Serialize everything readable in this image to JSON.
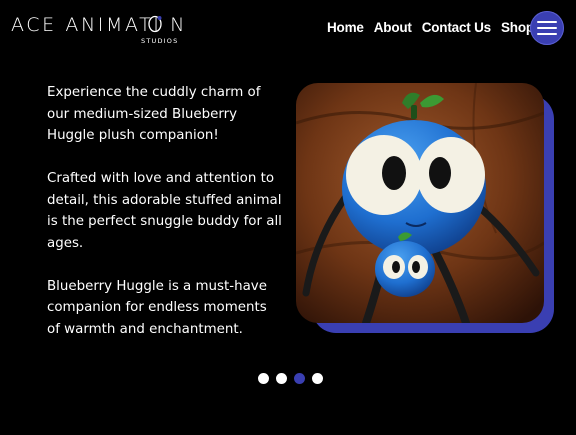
{
  "brand": {
    "name": "ACE ANIMATI N",
    "subtitle": "STUDIOS"
  },
  "nav": {
    "items": [
      "Home",
      "About",
      "Contact Us",
      "Shop"
    ],
    "menu_icon": "hamburger-icon"
  },
  "content": {
    "paragraphs": [
      "Experience the cuddly charm of our medium-sized Blueberry Huggle plush companion!",
      "Crafted with love and attention to detail, this adorable stuffed animal is the perfect snuggle buddy for all ages.",
      "Blueberry Huggle is a must-have companion for endless moments of warmth and enchantment."
    ]
  },
  "carousel": {
    "slide_count": 4,
    "active_index": 2
  },
  "colors": {
    "background": "#000000",
    "accent": "#3a3fb2",
    "text": "#ffffff"
  }
}
